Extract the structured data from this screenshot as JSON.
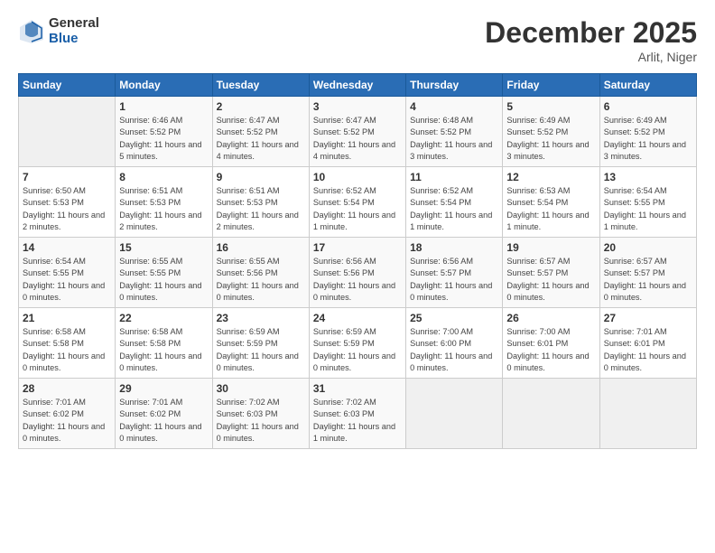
{
  "logo": {
    "general": "General",
    "blue": "Blue"
  },
  "title": "December 2025",
  "location": "Arlit, Niger",
  "days_of_week": [
    "Sunday",
    "Monday",
    "Tuesday",
    "Wednesday",
    "Thursday",
    "Friday",
    "Saturday"
  ],
  "weeks": [
    [
      {
        "num": "",
        "empty": true
      },
      {
        "num": "1",
        "sunrise": "Sunrise: 6:46 AM",
        "sunset": "Sunset: 5:52 PM",
        "daylight": "Daylight: 11 hours and 5 minutes."
      },
      {
        "num": "2",
        "sunrise": "Sunrise: 6:47 AM",
        "sunset": "Sunset: 5:52 PM",
        "daylight": "Daylight: 11 hours and 4 minutes."
      },
      {
        "num": "3",
        "sunrise": "Sunrise: 6:47 AM",
        "sunset": "Sunset: 5:52 PM",
        "daylight": "Daylight: 11 hours and 4 minutes."
      },
      {
        "num": "4",
        "sunrise": "Sunrise: 6:48 AM",
        "sunset": "Sunset: 5:52 PM",
        "daylight": "Daylight: 11 hours and 3 minutes."
      },
      {
        "num": "5",
        "sunrise": "Sunrise: 6:49 AM",
        "sunset": "Sunset: 5:52 PM",
        "daylight": "Daylight: 11 hours and 3 minutes."
      },
      {
        "num": "6",
        "sunrise": "Sunrise: 6:49 AM",
        "sunset": "Sunset: 5:52 PM",
        "daylight": "Daylight: 11 hours and 3 minutes."
      }
    ],
    [
      {
        "num": "7",
        "sunrise": "Sunrise: 6:50 AM",
        "sunset": "Sunset: 5:53 PM",
        "daylight": "Daylight: 11 hours and 2 minutes."
      },
      {
        "num": "8",
        "sunrise": "Sunrise: 6:51 AM",
        "sunset": "Sunset: 5:53 PM",
        "daylight": "Daylight: 11 hours and 2 minutes."
      },
      {
        "num": "9",
        "sunrise": "Sunrise: 6:51 AM",
        "sunset": "Sunset: 5:53 PM",
        "daylight": "Daylight: 11 hours and 2 minutes."
      },
      {
        "num": "10",
        "sunrise": "Sunrise: 6:52 AM",
        "sunset": "Sunset: 5:54 PM",
        "daylight": "Daylight: 11 hours and 1 minute."
      },
      {
        "num": "11",
        "sunrise": "Sunrise: 6:52 AM",
        "sunset": "Sunset: 5:54 PM",
        "daylight": "Daylight: 11 hours and 1 minute."
      },
      {
        "num": "12",
        "sunrise": "Sunrise: 6:53 AM",
        "sunset": "Sunset: 5:54 PM",
        "daylight": "Daylight: 11 hours and 1 minute."
      },
      {
        "num": "13",
        "sunrise": "Sunrise: 6:54 AM",
        "sunset": "Sunset: 5:55 PM",
        "daylight": "Daylight: 11 hours and 1 minute."
      }
    ],
    [
      {
        "num": "14",
        "sunrise": "Sunrise: 6:54 AM",
        "sunset": "Sunset: 5:55 PM",
        "daylight": "Daylight: 11 hours and 0 minutes."
      },
      {
        "num": "15",
        "sunrise": "Sunrise: 6:55 AM",
        "sunset": "Sunset: 5:55 PM",
        "daylight": "Daylight: 11 hours and 0 minutes."
      },
      {
        "num": "16",
        "sunrise": "Sunrise: 6:55 AM",
        "sunset": "Sunset: 5:56 PM",
        "daylight": "Daylight: 11 hours and 0 minutes."
      },
      {
        "num": "17",
        "sunrise": "Sunrise: 6:56 AM",
        "sunset": "Sunset: 5:56 PM",
        "daylight": "Daylight: 11 hours and 0 minutes."
      },
      {
        "num": "18",
        "sunrise": "Sunrise: 6:56 AM",
        "sunset": "Sunset: 5:57 PM",
        "daylight": "Daylight: 11 hours and 0 minutes."
      },
      {
        "num": "19",
        "sunrise": "Sunrise: 6:57 AM",
        "sunset": "Sunset: 5:57 PM",
        "daylight": "Daylight: 11 hours and 0 minutes."
      },
      {
        "num": "20",
        "sunrise": "Sunrise: 6:57 AM",
        "sunset": "Sunset: 5:57 PM",
        "daylight": "Daylight: 11 hours and 0 minutes."
      }
    ],
    [
      {
        "num": "21",
        "sunrise": "Sunrise: 6:58 AM",
        "sunset": "Sunset: 5:58 PM",
        "daylight": "Daylight: 11 hours and 0 minutes."
      },
      {
        "num": "22",
        "sunrise": "Sunrise: 6:58 AM",
        "sunset": "Sunset: 5:58 PM",
        "daylight": "Daylight: 11 hours and 0 minutes."
      },
      {
        "num": "23",
        "sunrise": "Sunrise: 6:59 AM",
        "sunset": "Sunset: 5:59 PM",
        "daylight": "Daylight: 11 hours and 0 minutes."
      },
      {
        "num": "24",
        "sunrise": "Sunrise: 6:59 AM",
        "sunset": "Sunset: 5:59 PM",
        "daylight": "Daylight: 11 hours and 0 minutes."
      },
      {
        "num": "25",
        "sunrise": "Sunrise: 7:00 AM",
        "sunset": "Sunset: 6:00 PM",
        "daylight": "Daylight: 11 hours and 0 minutes."
      },
      {
        "num": "26",
        "sunrise": "Sunrise: 7:00 AM",
        "sunset": "Sunset: 6:01 PM",
        "daylight": "Daylight: 11 hours and 0 minutes."
      },
      {
        "num": "27",
        "sunrise": "Sunrise: 7:01 AM",
        "sunset": "Sunset: 6:01 PM",
        "daylight": "Daylight: 11 hours and 0 minutes."
      }
    ],
    [
      {
        "num": "28",
        "sunrise": "Sunrise: 7:01 AM",
        "sunset": "Sunset: 6:02 PM",
        "daylight": "Daylight: 11 hours and 0 minutes."
      },
      {
        "num": "29",
        "sunrise": "Sunrise: 7:01 AM",
        "sunset": "Sunset: 6:02 PM",
        "daylight": "Daylight: 11 hours and 0 minutes."
      },
      {
        "num": "30",
        "sunrise": "Sunrise: 7:02 AM",
        "sunset": "Sunset: 6:03 PM",
        "daylight": "Daylight: 11 hours and 0 minutes."
      },
      {
        "num": "31",
        "sunrise": "Sunrise: 7:02 AM",
        "sunset": "Sunset: 6:03 PM",
        "daylight": "Daylight: 11 hours and 1 minute."
      },
      {
        "num": "",
        "empty": true
      },
      {
        "num": "",
        "empty": true
      },
      {
        "num": "",
        "empty": true
      }
    ]
  ]
}
